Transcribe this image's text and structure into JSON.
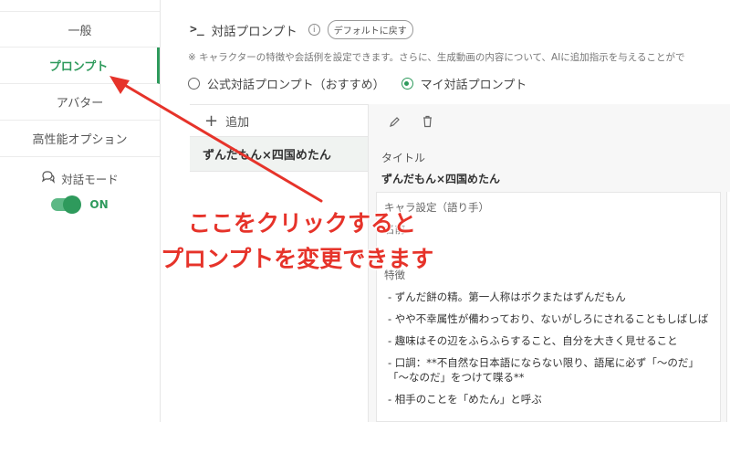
{
  "sidebar": {
    "items": [
      {
        "label": "一般"
      },
      {
        "label": "プロンプト"
      },
      {
        "label": "アバター"
      },
      {
        "label": "高性能オプション"
      }
    ],
    "mode_label": "対話モード",
    "toggle_label": "ON",
    "toggle_on": true
  },
  "header": {
    "title": "対話プロンプト",
    "reset_label": "デフォルトに戻す",
    "description": "※ キャラクターの特徴や会話例を設定できます。さらに、生成動画の内容について、AIに追加指示を与えることがで"
  },
  "radio": {
    "official_label": "公式対話プロンプト（おすすめ）",
    "mine_label": "マイ対話プロンプト",
    "selected": "mine"
  },
  "list": {
    "add_label": "追加",
    "items": [
      "ずんだもん×四国めたん"
    ]
  },
  "editor": {
    "title_label": "タイトル",
    "title_value": "ずんだもん×四国めたん",
    "char_setting_label": "キャラ設定（語り手）",
    "name_label": "名前",
    "trait_label": "特徴",
    "traits": [
      "- ずんだ餅の精。第一人称はボクまたはずんだもん",
      "- やや不幸属性が備わっており、ないがしろにされることもしばしば",
      "- 趣味はその辺をふらふらすること、自分を大きく見せること",
      "- 口調：**不自然な日本語にならない限り、語尾に必ず「〜のだ」",
      "「〜なのだ」をつけて喋る**",
      "- 相手のことを「めたん」と呼ぶ"
    ]
  },
  "annotation": {
    "line1": "ここをクリックすると",
    "line2": "プロンプトを変更できます",
    "color": "#e6332a"
  },
  "colors": {
    "accent": "#2e9a5c",
    "annotation": "#e6332a"
  }
}
